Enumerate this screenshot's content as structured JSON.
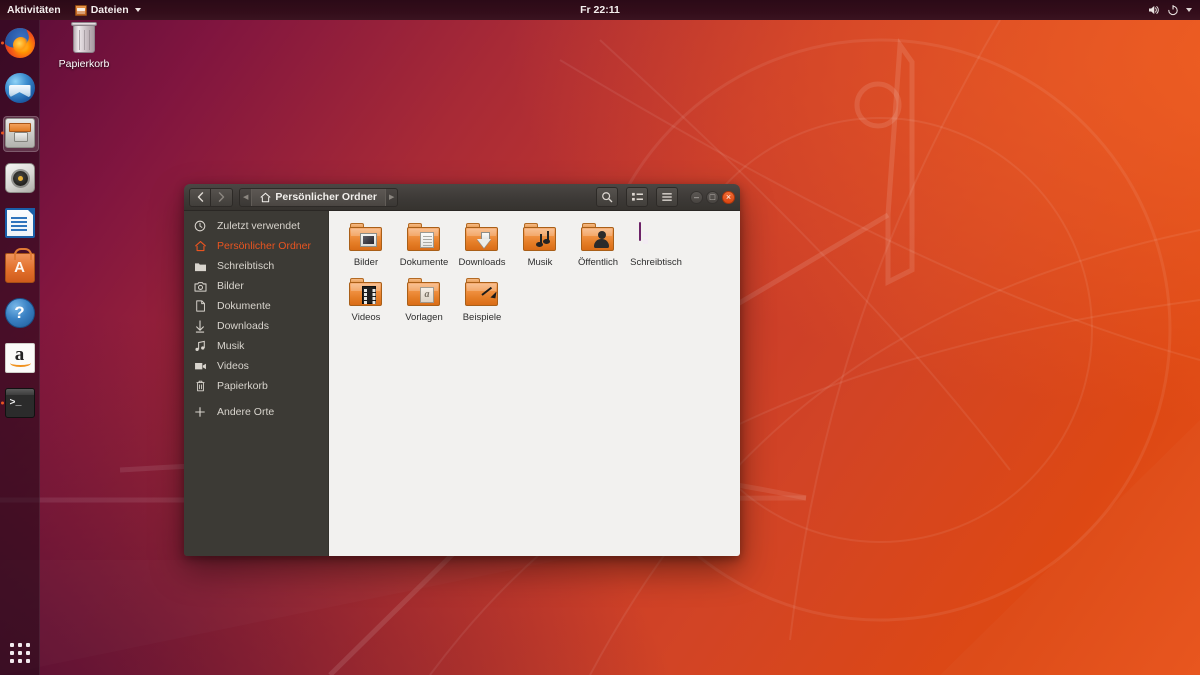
{
  "topbar": {
    "activities": "Aktivitäten",
    "app_menu": "Dateien",
    "app_icon": "files-mini-icon",
    "clock": "Fr 22:11",
    "volume_icon": "speaker-icon",
    "power_icon": "power-icon",
    "menu_caret_icon": "chevron-down-icon"
  },
  "dock": {
    "items": [
      {
        "name": "firefox",
        "label": "Firefox",
        "running": true,
        "active": false
      },
      {
        "name": "thunderbird",
        "label": "Thunderbird",
        "running": false,
        "active": false
      },
      {
        "name": "files",
        "label": "Dateien",
        "running": true,
        "active": true
      },
      {
        "name": "rhythmbox",
        "label": "Rhythmbox",
        "running": false,
        "active": false
      },
      {
        "name": "libreoffice-writer",
        "label": "LibreOffice Writer",
        "running": false,
        "active": false
      },
      {
        "name": "ubuntu-software",
        "label": "Ubuntu Software",
        "running": false,
        "active": false
      },
      {
        "name": "help",
        "label": "Hilfe",
        "running": false,
        "active": false
      },
      {
        "name": "amazon",
        "label": "Amazon",
        "running": false,
        "active": false
      },
      {
        "name": "terminal",
        "label": "Terminal",
        "running": true,
        "active": false
      }
    ],
    "show_apps_label": "Anwendungen anzeigen",
    "show_apps_icon": "apps-grid-icon"
  },
  "desktop": {
    "icons": [
      {
        "name": "trash",
        "label": "Papierkorb",
        "icon": "trash-icon"
      }
    ]
  },
  "file_manager": {
    "window_title": "Persönlicher Ordner",
    "nav": {
      "back_icon": "chevron-left-icon",
      "forward_icon": "chevron-right-icon",
      "crumb_prev_icon": "chevron-left-small-icon",
      "crumb_next_icon": "chevron-right-small-icon",
      "home_icon": "home-icon"
    },
    "toolbar": {
      "search_icon": "search-icon",
      "view_toggle_icon": "list-view-icon",
      "menu_icon": "hamburger-menu-icon"
    },
    "window_controls": {
      "minimize": "–",
      "maximize": "□",
      "close": "×"
    },
    "sidebar": [
      {
        "label": "Zuletzt verwendet",
        "icon": "clock-icon",
        "selected": false
      },
      {
        "label": "Persönlicher Ordner",
        "icon": "home-icon",
        "selected": true
      },
      {
        "label": "Schreibtisch",
        "icon": "folder-icon",
        "selected": false
      },
      {
        "label": "Bilder",
        "icon": "camera-icon",
        "selected": false
      },
      {
        "label": "Dokumente",
        "icon": "document-icon",
        "selected": false
      },
      {
        "label": "Downloads",
        "icon": "download-arrow-icon",
        "selected": false
      },
      {
        "label": "Musik",
        "icon": "music-note-icon",
        "selected": false
      },
      {
        "label": "Videos",
        "icon": "video-icon",
        "selected": false
      },
      {
        "label": "Papierkorb",
        "icon": "trash-icon",
        "selected": false
      },
      {
        "label": "Andere Orte",
        "icon": "plus-icon",
        "selected": false
      }
    ],
    "files": [
      {
        "label": "Bilder",
        "kind": "folder",
        "overlay": "photo"
      },
      {
        "label": "Dokumente",
        "kind": "folder",
        "overlay": "page"
      },
      {
        "label": "Downloads",
        "kind": "folder",
        "overlay": "arrow"
      },
      {
        "label": "Musik",
        "kind": "folder",
        "overlay": "note"
      },
      {
        "label": "Öffentlich",
        "kind": "folder",
        "overlay": "person"
      },
      {
        "label": "Schreibtisch",
        "kind": "desktop-window",
        "overlay": ""
      },
      {
        "label": "Videos",
        "kind": "folder",
        "overlay": "film"
      },
      {
        "label": "Vorlagen",
        "kind": "folder",
        "overlay": "tpl"
      },
      {
        "label": "Beispiele",
        "kind": "folder",
        "overlay": "link"
      }
    ]
  },
  "colors": {
    "accent": "#e95420",
    "topbar_bg": "#33121c",
    "window_header": "#3d3a37",
    "sidebar_bg": "#3c3a35",
    "content_bg": "#f2f1ef",
    "close_button": "#db4511"
  }
}
